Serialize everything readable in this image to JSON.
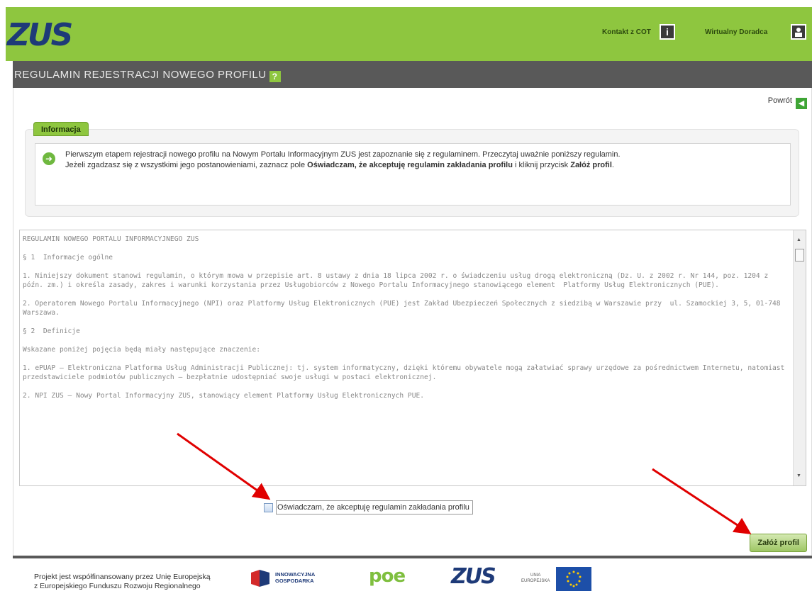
{
  "header": {
    "logo": "ZUS",
    "contact_label": "Kontakt z COT",
    "advisor_label": "Wirtualny Doradca"
  },
  "titlebar": {
    "title": "REGULAMIN REJESTRACJI NOWEGO PROFILU",
    "help_glyph": "?"
  },
  "nav": {
    "back_label": "Powrót"
  },
  "info": {
    "tab_label": "Informacja",
    "line1": "Pierwszym etapem rejestracji nowego profilu na Nowym Portalu Informacyjnym ZUS jest zapoznanie się z regulaminem. Przeczytaj uważnie poniższy regulamin.",
    "line2_pre": "Jeżeli zgadzasz się z wszystkimi jego postanowieniami, zaznacz pole ",
    "line2_bold": "Oświadczam, że akceptuję regulamin zakładania profilu",
    "line2_mid": " i kliknij przycisk ",
    "line2_btn": "Załóż profil",
    "line2_end": "."
  },
  "terms": {
    "text": "REGULAMIN NOWEGO PORTALU INFORMACYJNEGO ZUS\n\n§ 1  Informacje ogólne\n\n1. Niniejszy dokument stanowi regulamin, o którym mowa w przepisie art. 8 ustawy z dnia 18 lipca 2002 r. o świadczeniu usług drogą elektroniczną (Dz. U. z 2002 r. Nr 144, poz. 1204 z późn. zm.) i określa zasady, zakres i warunki korzystania przez Usługobiorców z Nowego Portalu Informacyjnego stanowiącego element  Platformy Usług Elektronicznych (PUE).\n\n2. Operatorem Nowego Portalu Informacyjnego (NPI) oraz Platformy Usług Elektronicznych (PUE) jest Zakład Ubezpieczeń Społecznych z siedzibą w Warszawie przy  ul. Szamockiej 3, 5, 01-748 Warszawa.\n\n§ 2  Definicje\n\nWskazane poniżej pojęcia będą miały następujące znaczenie:\n\n1. ePUAP – Elektroniczna Platforma Usług Administracji Publicznej: tj. system informatyczny, dzięki któremu obywatele mogą załatwiać sprawy urzędowe za pośrednictwem Internetu, natomiast przedstawiciele podmiotów publicznych – bezpłatnie udostępniać swoje usługi w postaci elektronicznej.\n\n2. NPI ZUS – Nowy Portal Informacyjny ZUS, stanowiący element Platformy Usług Elektronicznych PUE."
  },
  "accept": {
    "label": "Oświadczam, że akceptuję regulamin zakładania profilu"
  },
  "submit": {
    "label": "Załóż profil"
  },
  "footer": {
    "line1": "Projekt jest współfinansowany przez Unię Europejską",
    "line2": "z Europejskiego Funduszu Rozwoju Regionalnego",
    "ig_line1": "INNOWACYJNA",
    "ig_line2": "GOSPODARKA",
    "poe": "poe",
    "zus": "ZUS",
    "ue_line1": "UNIA",
    "ue_line2": "EUROPEJSKA"
  },
  "colors": {
    "brand_green": "#8ec63f",
    "brand_blue": "#1e3a78",
    "titlebar_gray": "#595959",
    "annotation_red": "#e00000"
  }
}
